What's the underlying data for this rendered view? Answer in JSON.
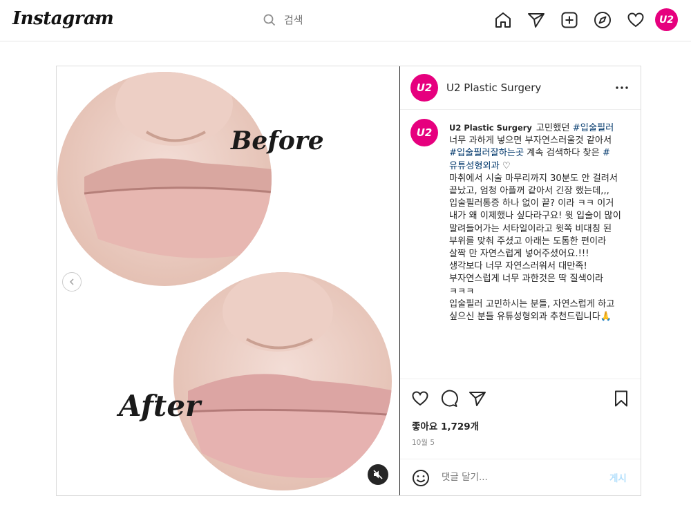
{
  "app": {
    "logo_text": "Instagram",
    "search_placeholder": "검색",
    "profile_avatar_text": "U2",
    "brand_color": "#e6007e",
    "nav_icons": [
      "home-icon",
      "direct-icon",
      "new-post-icon",
      "explore-icon",
      "activity-icon"
    ]
  },
  "post": {
    "media": {
      "before_label": "Before",
      "after_label": "After"
    },
    "account": {
      "name": "U2 Plastic Surgery",
      "avatar_text": "U2"
    },
    "caption": {
      "username": "U2 Plastic Surgery",
      "lines": [
        {
          "text": "고민했던 ",
          "tag": "#입술필러"
        },
        {
          "text": "너무 과하게 넣으면 부자연스러울것 같아서 ",
          "tag": "#입술필러잘하는곳"
        },
        {
          "text": " 계속 검색하다 찾은 ",
          "tag": "#유튜성형외과"
        },
        {
          "text": " ♡"
        }
      ],
      "paragraphs": [
        "마취에서 시술 마무리까지 30분도 안 걸려서 끝났고, 엄청 아플꺼 같아서 긴장 했는데,,, 입술필러통증 하나 없이 끝? 이라 ㅋㅋ 이거 내가 왜 이제했나 싶다라구요! 윗 입술이 많이 말려들어가는 서타일이라고 윗쪽 비대칭 된 부위를 맞춰 주셨고 아래는 도톰한 편이라 살짝 만 자연스럽게 넣어주셨어요.!!!",
        "생각보다 너무 자연스러워서 대만족! 부자연스럽게 너무 과한것은 딱 질색이라 ㅋㅋㅋ",
        "입술필러 고민하시는 분들, 자연스럽게 하고 싶으신 분들 유튜성형외과 추천드립니다🙏"
      ]
    },
    "likes_text": "좋아요 1,729개",
    "date_text": "10월 5",
    "comment_placeholder": "댓글 달기...",
    "post_button_label": "게시"
  }
}
